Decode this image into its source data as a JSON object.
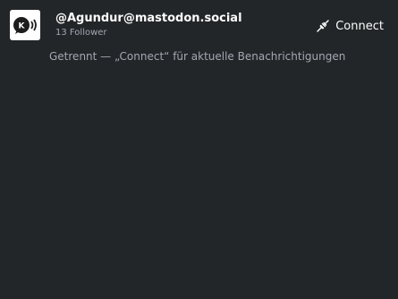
{
  "account": {
    "handle": "@Agundur@mastodon.social",
    "followers": "13 Follower",
    "avatar_icon": "mastodon-speaker-icon"
  },
  "actions": {
    "connect_label": "Connect",
    "connect_icon": "plug-icon"
  },
  "status": {
    "message": "Getrennt — „Connect“ für aktuelle Benachrichtigungen"
  },
  "colors": {
    "background": "#232629",
    "text": "#fcfcfc",
    "muted_text": "#a1a9b1"
  }
}
